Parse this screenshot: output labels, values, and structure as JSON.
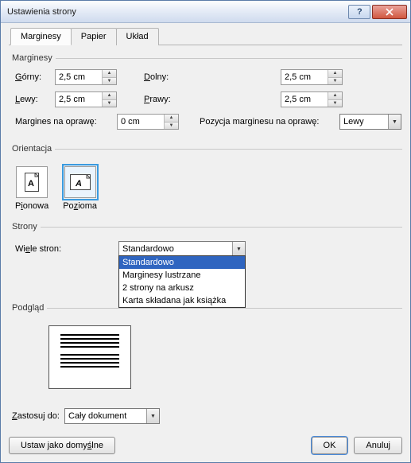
{
  "title": "Ustawienia strony",
  "tabs": {
    "margins": "Marginesy",
    "paper": "Papier",
    "layout": "Układ"
  },
  "group_margins": "Marginesy",
  "group_orientation": "Orientacja",
  "group_pages": "Strony",
  "group_preview": "Podgląd",
  "margins": {
    "top_label": "Górny:",
    "top_value": "2,5 cm",
    "bottom_label": "Dolny:",
    "bottom_value": "2,5 cm",
    "left_label": "Lewy:",
    "left_value": "2,5 cm",
    "right_label": "Prawy:",
    "right_value": "2,5 cm",
    "gutter_label": "Margines na oprawę:",
    "gutter_value": "0 cm",
    "gutter_pos_label": "Pozycja marginesu na oprawę:",
    "gutter_pos_value": "Lewy"
  },
  "orientation": {
    "portrait": "Pionowa",
    "landscape": "Pozioma"
  },
  "pages": {
    "label": "Wiele stron:",
    "selected": "Standardowo",
    "options": [
      "Standardowo",
      "Marginesy lustrzane",
      "2 strony na arkusz",
      "Karta składana jak książka"
    ]
  },
  "apply": {
    "label": "Zastosuj do:",
    "value": "Cały dokument"
  },
  "buttons": {
    "default": "Ustaw jako domyślne",
    "ok": "OK",
    "cancel": "Anuluj"
  }
}
